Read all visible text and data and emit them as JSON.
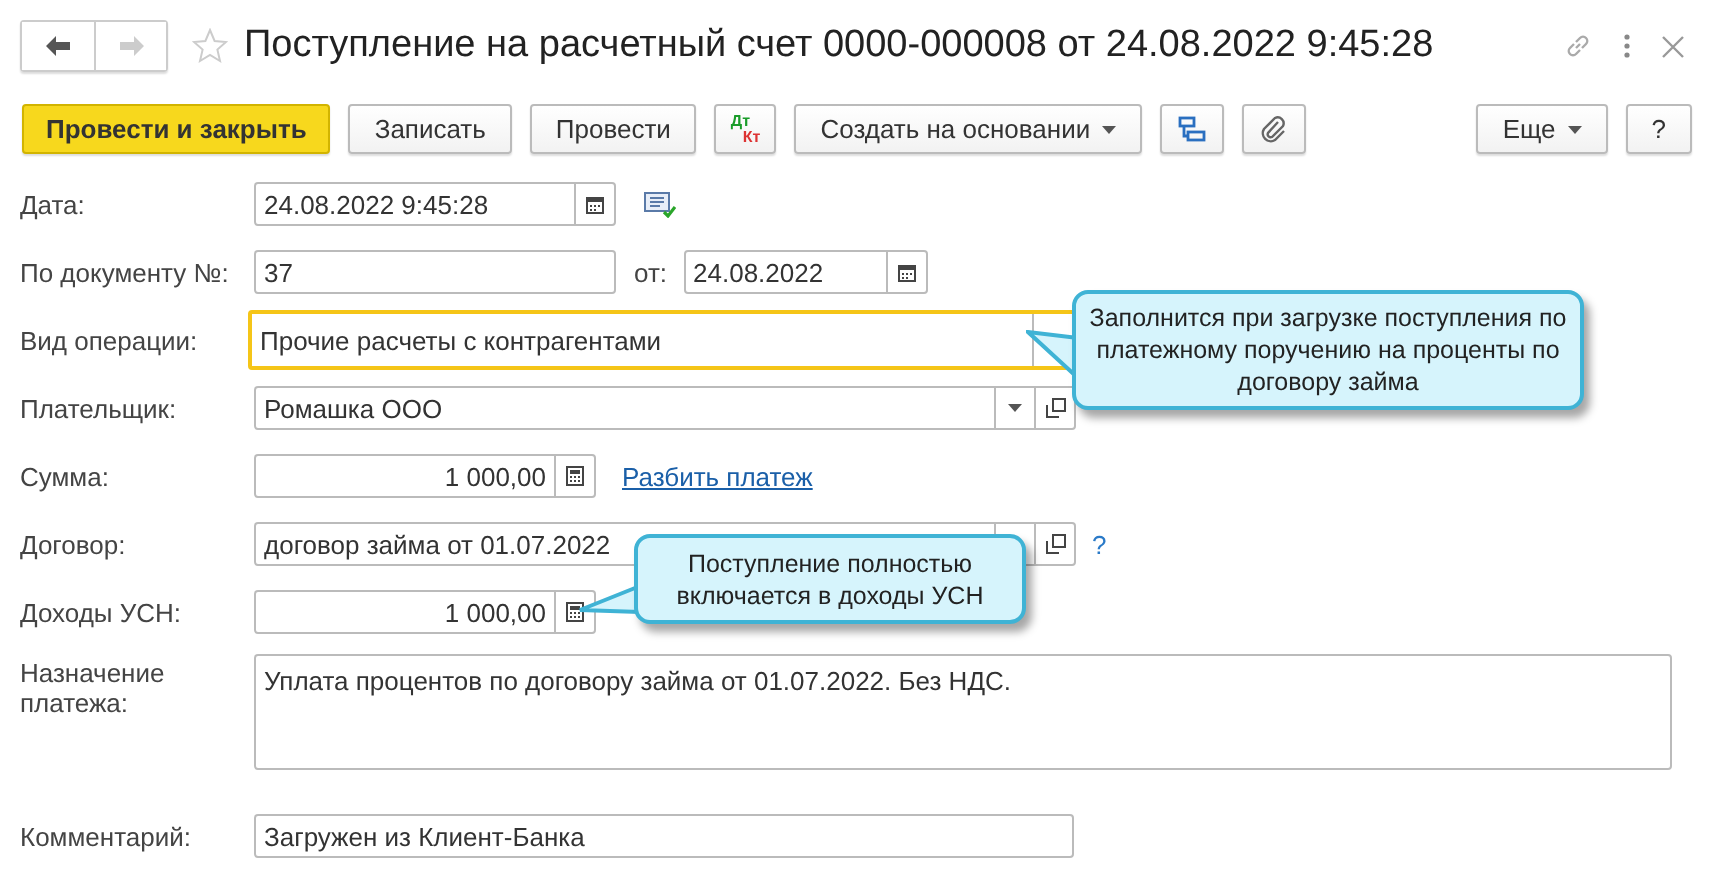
{
  "window": {
    "title": "Поступление на расчетный счет 0000-000008 от 24.08.2022 9:45:28"
  },
  "toolbar": {
    "buttons": [
      {
        "label": "Провести и закрыть",
        "kind": "primary"
      },
      {
        "label": "Записать",
        "kind": "plain"
      },
      {
        "label": "Провести",
        "kind": "plain"
      },
      {
        "label": "Дт",
        "label2": "Кт",
        "kind": "dtkt"
      },
      {
        "label": "Создать на основании",
        "kind": "menu"
      },
      {
        "kind": "structure"
      },
      {
        "kind": "clip"
      },
      {
        "label": "Еще",
        "kind": "menu"
      },
      {
        "label": "?",
        "kind": "plain"
      }
    ]
  },
  "form": {
    "date": {
      "label": "Дата:",
      "value": "24.08.2022  9:45:28"
    },
    "doc_number": {
      "label": "По документу №:",
      "value": "37",
      "date_label": "от:",
      "date_value": "24.08.2022"
    },
    "operation": {
      "label": "Вид операции:",
      "value": "Прочие расчеты с контрагентами"
    },
    "payer": {
      "label": "Плательщик:",
      "value": "Ромашка ООО"
    },
    "amount": {
      "label": "Сумма:",
      "value": "1 000,00",
      "link": "Разбить платеж"
    },
    "contract": {
      "label": "Договор:",
      "value": "договор займа от 01.07.2022",
      "help": "?"
    },
    "usn_income": {
      "label": "Доходы УСН:",
      "value": "1 000,00"
    },
    "purpose": {
      "label": "Назначение платежа:",
      "value": "Уплата процентов по договору займа от 01.07.2022. Без НДС."
    },
    "comment": {
      "label": "Комментарий:",
      "value": "Загружен из Клиент-Банка"
    }
  },
  "callouts": [
    {
      "text": "Заполнится при загрузке поступления по платежному поручению на проценты по договору займа"
    },
    {
      "text": "Поступление полностью включается в доходы УСН"
    }
  ]
}
